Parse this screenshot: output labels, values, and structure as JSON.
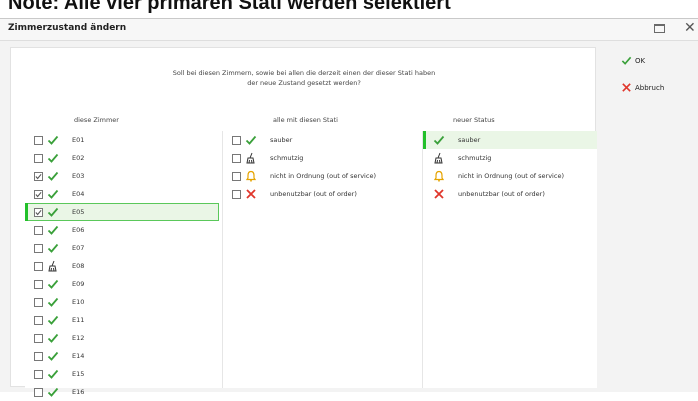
{
  "banner": {
    "text": "Note: Alle vier primaren Stati werden selektiert"
  },
  "window": {
    "title": "Zimmerzustand ändern"
  },
  "prompt": {
    "line1": "Soll bei diesen Zimmern, sowie bei allen die derzeit einen der dieser Stati haben",
    "line2": "der neue Zustand gesetzt werden?"
  },
  "columns": {
    "rooms": "diese Zimmer",
    "with_status": "alle mit diesen Stati",
    "new_status": "neuer Status"
  },
  "rooms": [
    {
      "label": "E01",
      "checked": false,
      "status": "check-icon"
    },
    {
      "label": "E02",
      "checked": false,
      "status": "check-icon"
    },
    {
      "label": "E03",
      "checked": true,
      "status": "check-icon"
    },
    {
      "label": "E04",
      "checked": true,
      "status": "check-icon"
    },
    {
      "label": "E05",
      "checked": true,
      "status": "check-icon"
    },
    {
      "label": "E06",
      "checked": false,
      "status": "check-icon"
    },
    {
      "label": "E07",
      "checked": false,
      "status": "check-icon"
    },
    {
      "label": "E08",
      "checked": false,
      "status": "broom-icon"
    },
    {
      "label": "E09",
      "checked": false,
      "status": "check-icon"
    },
    {
      "label": "E10",
      "checked": false,
      "status": "check-icon"
    },
    {
      "label": "E11",
      "checked": false,
      "status": "check-icon"
    },
    {
      "label": "E12",
      "checked": false,
      "status": "check-icon"
    },
    {
      "label": "E14",
      "checked": false,
      "status": "check-icon"
    },
    {
      "label": "E15",
      "checked": false,
      "status": "check-icon"
    },
    {
      "label": "E16",
      "checked": false,
      "status": "check-icon"
    }
  ],
  "status_filter": [
    {
      "label": "sauber",
      "checked": false,
      "status": "check-icon"
    },
    {
      "label": "schmutzig",
      "checked": false,
      "status": "broom-icon"
    },
    {
      "label": "nicht in Ordnung (out of service)",
      "checked": false,
      "status": "bell-icon"
    },
    {
      "label": "unbenutzbar (out of order)",
      "checked": false,
      "status": "cross-icon"
    }
  ],
  "new_status": [
    {
      "label": "sauber",
      "status": "check-icon"
    },
    {
      "label": "schmutzig",
      "status": "broom-icon"
    },
    {
      "label": "nicht in Ordnung (out of service)",
      "status": "bell-icon"
    },
    {
      "label": "unbenutzbar (out of order)",
      "status": "cross-icon"
    }
  ],
  "actions": {
    "ok": "OK",
    "cancel": "Abbruch"
  },
  "colors": {
    "accent": "#22c02a",
    "check": "#3aa03a",
    "cross": "#e0362b",
    "bell": "#e6a400"
  }
}
